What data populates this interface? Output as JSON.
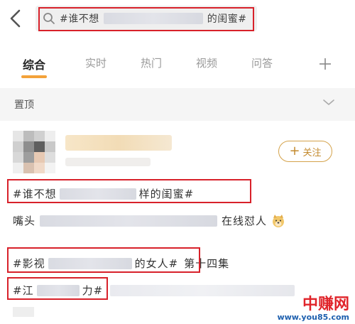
{
  "search": {
    "query_prefix": "#谁不想",
    "query_suffix": "的闺蜜#"
  },
  "tabs": [
    {
      "label": "综合",
      "active": true
    },
    {
      "label": "实时",
      "active": false
    },
    {
      "label": "热门",
      "active": false
    },
    {
      "label": "视频",
      "active": false
    },
    {
      "label": "问答",
      "active": false
    }
  ],
  "pinned": {
    "label": "置顶"
  },
  "post": {
    "follow_label": "关注",
    "line1": {
      "prefix": "#谁不想",
      "suffix": "样的闺蜜#"
    },
    "line2": {
      "prefix": "嘴头",
      "suffix": "在线怼人"
    },
    "line3": {
      "prefix": "#影视",
      "suffix": "的女人#",
      "after": "第十四集"
    },
    "line4": {
      "prefix": "#江",
      "suffix": "力#"
    }
  },
  "icons": {
    "back": "chevron-left-icon",
    "search": "search-icon",
    "add_tab": "plus-icon",
    "expand": "chevron-down-icon",
    "emoji": "doge-icon"
  },
  "colors": {
    "tab_accent": "#f3a23a",
    "highlight_box": "#d8212a",
    "follow": "#c38a2e"
  },
  "watermark": {
    "title": "中赚网",
    "url": "www.you85.com"
  }
}
